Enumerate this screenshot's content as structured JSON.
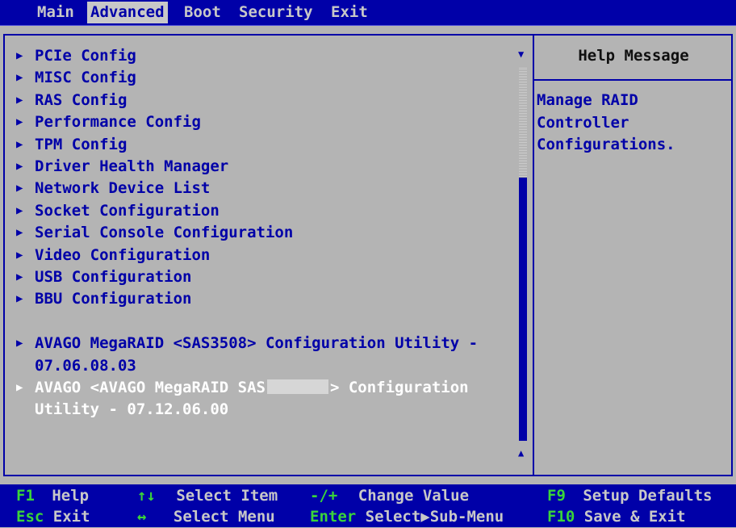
{
  "menu_bar": {
    "tabs": [
      {
        "label": "Main",
        "active": false
      },
      {
        "label": "Advanced",
        "active": true
      },
      {
        "label": "Boot",
        "active": false
      },
      {
        "label": "Security",
        "active": false
      },
      {
        "label": "Exit",
        "active": false
      }
    ]
  },
  "menu": {
    "items": [
      {
        "label": "PCIe Config"
      },
      {
        "label": "MISC Config"
      },
      {
        "label": "RAS Config"
      },
      {
        "label": "Performance Config"
      },
      {
        "label": "TPM Config"
      },
      {
        "label": "Driver Health Manager"
      },
      {
        "label": "Network Device List"
      },
      {
        "label": "Socket Configuration"
      },
      {
        "label": "Serial Console Configuration"
      },
      {
        "label": "Video Configuration"
      },
      {
        "label": "USB Configuration"
      },
      {
        "label": "BBU Configuration"
      }
    ],
    "raid_items": [
      {
        "line1": "AVAGO MegaRAID <SAS3508> Configuration Utility -",
        "line2": "07.06.08.03"
      },
      {
        "line1_pre": "AVAGO <AVAGO MegaRAID SAS",
        "line1_post": "> Configuration",
        "line2": "Utility - 07.12.06.00",
        "selected": true
      }
    ],
    "arrow_glyph": "▶"
  },
  "help": {
    "title": "Help Message",
    "body": "Manage RAID\nController\nConfigurations."
  },
  "scrollbar": {
    "down_glyph": "▼",
    "up_glyph": "▲"
  },
  "footer": {
    "hints": [
      {
        "key": "F1",
        "text": "Help"
      },
      {
        "key": "↑↓",
        "text": "Select Item"
      },
      {
        "key": "-/+",
        "text": "Change Value"
      },
      {
        "key": "F9",
        "text": "Setup Defaults"
      },
      {
        "key": "Esc",
        "text": "Exit"
      },
      {
        "key": "↔",
        "text": "Select Menu"
      },
      {
        "key": "Enter",
        "text": "Select▶Sub-Menu"
      },
      {
        "key": "F10",
        "text": "Save & Exit"
      }
    ]
  },
  "colors": {
    "bar_blue": "#0000a8",
    "panel_gray": "#b4b4b4",
    "key_green": "#3ad43a",
    "selected_text": "#ffffff"
  }
}
